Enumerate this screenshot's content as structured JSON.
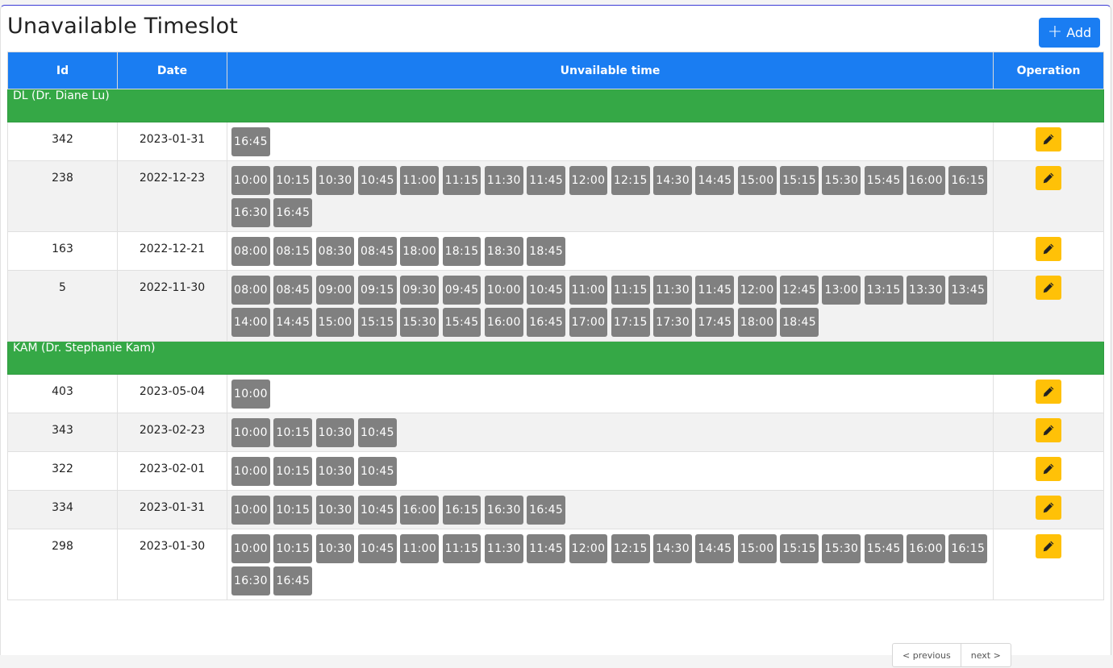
{
  "page": {
    "title": "Unavailable Timeslot",
    "add_label": "Add"
  },
  "table": {
    "headers": {
      "id": "Id",
      "date": "Date",
      "unavailable": "Unvailable time",
      "operation": "Operation"
    },
    "groups": [
      {
        "label": "DL (Dr. Diane Lu)",
        "rows": [
          {
            "id": "342",
            "date": "2023-01-31",
            "times": [
              "16:45"
            ]
          },
          {
            "id": "238",
            "date": "2022-12-23",
            "times": [
              "10:00",
              "10:15",
              "10:30",
              "10:45",
              "11:00",
              "11:15",
              "11:30",
              "11:45",
              "12:00",
              "12:15",
              "14:30",
              "14:45",
              "15:00",
              "15:15",
              "15:30",
              "15:45",
              "16:00",
              "16:15",
              "16:30",
              "16:45"
            ]
          },
          {
            "id": "163",
            "date": "2022-12-21",
            "times": [
              "08:00",
              "08:15",
              "08:30",
              "08:45",
              "18:00",
              "18:15",
              "18:30",
              "18:45"
            ]
          },
          {
            "id": "5",
            "date": "2022-11-30",
            "times": [
              "08:00",
              "08:45",
              "09:00",
              "09:15",
              "09:30",
              "09:45",
              "10:00",
              "10:45",
              "11:00",
              "11:15",
              "11:30",
              "11:45",
              "12:00",
              "12:45",
              "13:00",
              "13:15",
              "13:30",
              "13:45",
              "14:00",
              "14:45",
              "15:00",
              "15:15",
              "15:30",
              "15:45",
              "16:00",
              "16:45",
              "17:00",
              "17:15",
              "17:30",
              "17:45",
              "18:00",
              "18:45"
            ]
          }
        ]
      },
      {
        "label": "KAM (Dr. Stephanie Kam)",
        "rows": [
          {
            "id": "403",
            "date": "2023-05-04",
            "times": [
              "10:00"
            ]
          },
          {
            "id": "343",
            "date": "2023-02-23",
            "times": [
              "10:00",
              "10:15",
              "10:30",
              "10:45"
            ]
          },
          {
            "id": "322",
            "date": "2023-02-01",
            "times": [
              "10:00",
              "10:15",
              "10:30",
              "10:45"
            ]
          },
          {
            "id": "334",
            "date": "2023-01-31",
            "times": [
              "10:00",
              "10:15",
              "10:30",
              "10:45",
              "16:00",
              "16:15",
              "16:30",
              "16:45"
            ]
          },
          {
            "id": "298",
            "date": "2023-01-30",
            "times": [
              "10:00",
              "10:15",
              "10:30",
              "10:45",
              "11:00",
              "11:15",
              "11:30",
              "11:45",
              "12:00",
              "12:15",
              "14:30",
              "14:45",
              "15:00",
              "15:15",
              "15:30",
              "15:45",
              "16:00",
              "16:15",
              "16:30",
              "16:45"
            ]
          }
        ]
      }
    ]
  },
  "pager": {
    "previous": "< previous",
    "next": "next >"
  },
  "icons": {
    "add": "plus-icon",
    "edit": "pencil-icon"
  },
  "colors": {
    "primary": "#1a7df2",
    "group": "#35a846",
    "slot": "#808080",
    "edit": "#ffc107"
  }
}
